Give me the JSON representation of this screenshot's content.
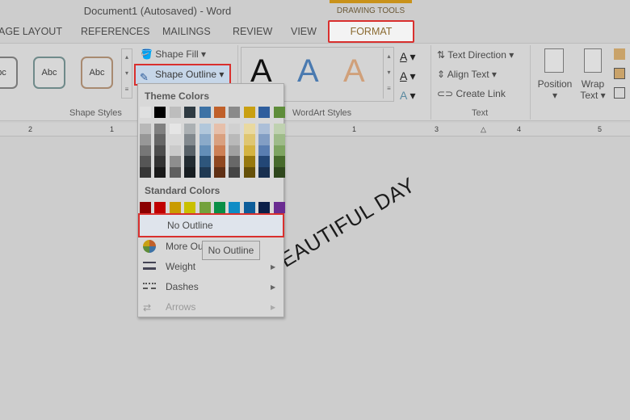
{
  "window": {
    "title": "Document1 (Autosaved) - Word"
  },
  "contextual": {
    "label": "DRAWING TOOLS",
    "accent": "#c9921a"
  },
  "tabs": [
    {
      "label": "AGE LAYOUT"
    },
    {
      "label": "REFERENCES"
    },
    {
      "label": "MAILINGS"
    },
    {
      "label": "REVIEW"
    },
    {
      "label": "VIEW"
    },
    {
      "label": "FORMAT",
      "active": true
    }
  ],
  "ribbon": {
    "shape_styles": {
      "samples": [
        "bc",
        "Abc",
        "Abc"
      ],
      "shape_fill": "Shape Fill",
      "shape_outline": "Shape Outline",
      "group": "Shape Styles"
    },
    "wordart": {
      "sample": "A",
      "group": "WordArt Styles"
    },
    "text": {
      "text_direction": "Text Direction",
      "align_text": "Align Text",
      "create_link": "Create Link",
      "group": "Text"
    },
    "arrange": {
      "position": "Position",
      "wrap_1": "Wrap",
      "wrap_2": "Text"
    }
  },
  "ruler": {
    "labels": [
      "2",
      "1",
      "1",
      "2",
      "3",
      "4",
      "5"
    ]
  },
  "menu": {
    "theme_header": "Theme Colors",
    "theme_colors": [
      "#e0e0e0",
      "#000000",
      "#bdbdbd",
      "#2e3a42",
      "#3d72a5",
      "#c0602a",
      "#8a8a8a",
      "#c9a012",
      "#2f5e9d",
      "#5e8d3a"
    ],
    "standard_header": "Standard Colors",
    "standard_colors": [
      "#8b0000",
      "#c00000",
      "#c99b00",
      "#c9c000",
      "#73a13c",
      "#0a8f47",
      "#0f8cc5",
      "#0d5d9a",
      "#0b1f48",
      "#6a2c91"
    ],
    "no_outline": "No Outline",
    "more_colors": "More Ou",
    "weight": "Weight",
    "dashes": "Dashes",
    "arrows": "Arrows"
  },
  "tooltip": "No Outline",
  "highlight_color": "#d9302e",
  "document": {
    "wordart_text": "HAVE A BEAUTIFUL DAY"
  }
}
